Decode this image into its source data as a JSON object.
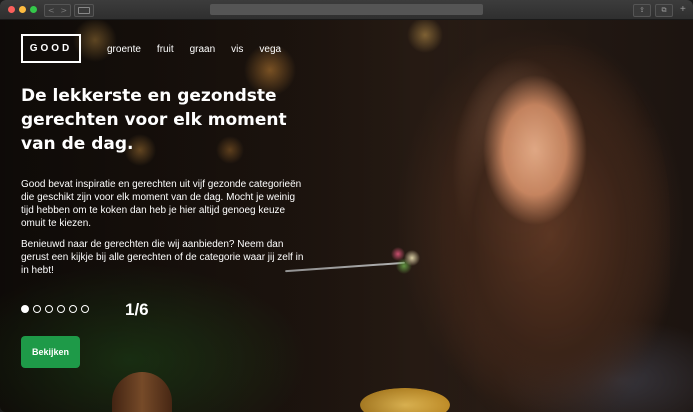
{
  "browser": {
    "back_glyph": "<",
    "forward_glyph": ">",
    "share_glyph": "⇪",
    "tabs_glyph": "⧉",
    "newtab_glyph": "+"
  },
  "logo": "GOOD",
  "nav": [
    "groente",
    "fruit",
    "graan",
    "vis",
    "vega"
  ],
  "hero": {
    "headline": "De lekkerste en gezondste gerechten voor elk moment van de dag.",
    "paragraph1": "Good bevat inspiratie en gerechten uit vijf gezonde categorieën die geschikt zijn voor elk moment van de dag. Mocht je weinig tijd hebben om te koken dan heb je hier altijd genoeg keuze omuit te kiezen.",
    "paragraph2": "Benieuwd naar de gerechten die wij aanbieden? Neem dan gerust een kijkje bij alle gerechten of de categorie waar jij zelf in in hebt!",
    "slide_counter": "1/6",
    "slide_total": 6,
    "slide_active": 1,
    "cta_label": "Bekijken"
  },
  "colors": {
    "accent": "#1e9a48",
    "text": "#ffffff"
  }
}
